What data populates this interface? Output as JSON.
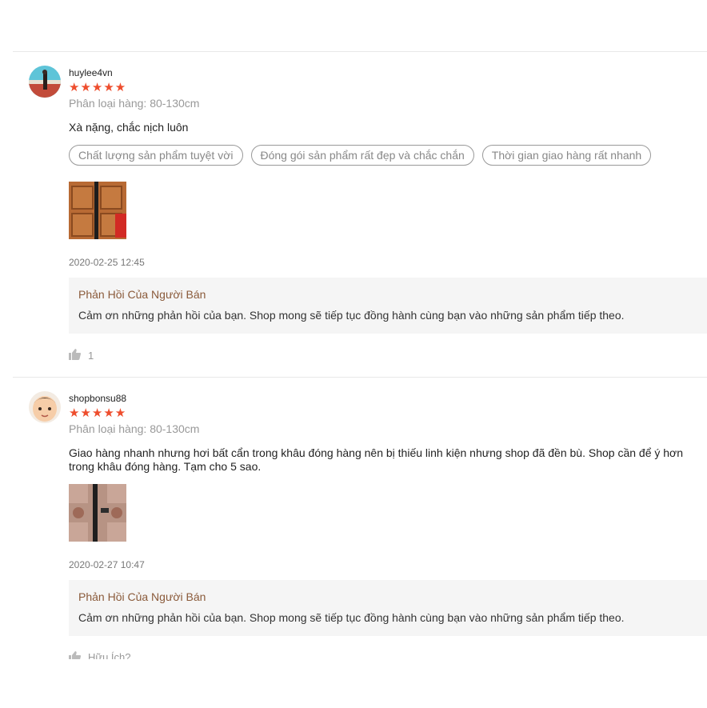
{
  "colors": {
    "star": "#ee4d2d",
    "reply_title": "#8a5a3a",
    "tag_border": "#999999"
  },
  "reviews": [
    {
      "username": "huylee4vn",
      "stars": "★★★★★",
      "variation": "Phân loại hàng: 80-130cm",
      "comment": "Xà nặng, chắc nịch luôn",
      "tags": [
        "Chất lượng sản phẩm tuyệt vời",
        "Đóng gói sản phẩm rất đẹp và chắc chắn",
        "Thời gian giao hàng rất nhanh"
      ],
      "time": "2020-02-25 12:45",
      "reply_title": "Phản Hồi Của Người Bán",
      "reply_text": "Cảm ơn những phản hồi của bạn. Shop mong sẽ tiếp tục đồng hành cùng bạn vào những sản phẩm tiếp theo.",
      "like_icon": "thumbs-up-icon",
      "likes": "1"
    },
    {
      "username": "shopbonsu88",
      "stars": "★★★★★",
      "variation": "Phân loại hàng: 80-130cm",
      "comment": "Giao hàng nhanh nhưng hơi bất cẩn trong khâu đóng hàng nên bị thiếu linh kiện nhưng shop đã đền bù. Shop cần để ý hơn trong khâu đóng hàng. Tạm cho 5 sao.",
      "time": "2020-02-27 10:47",
      "reply_title": "Phản Hồi Của Người Bán",
      "reply_text": "Cảm ơn những phản hồi của bạn. Shop mong sẽ tiếp tục đồng hành cùng bạn vào những sản phẩm tiếp theo.",
      "like_icon": "thumbs-up-icon",
      "helpful_label": "Hữu Ích?"
    }
  ]
}
